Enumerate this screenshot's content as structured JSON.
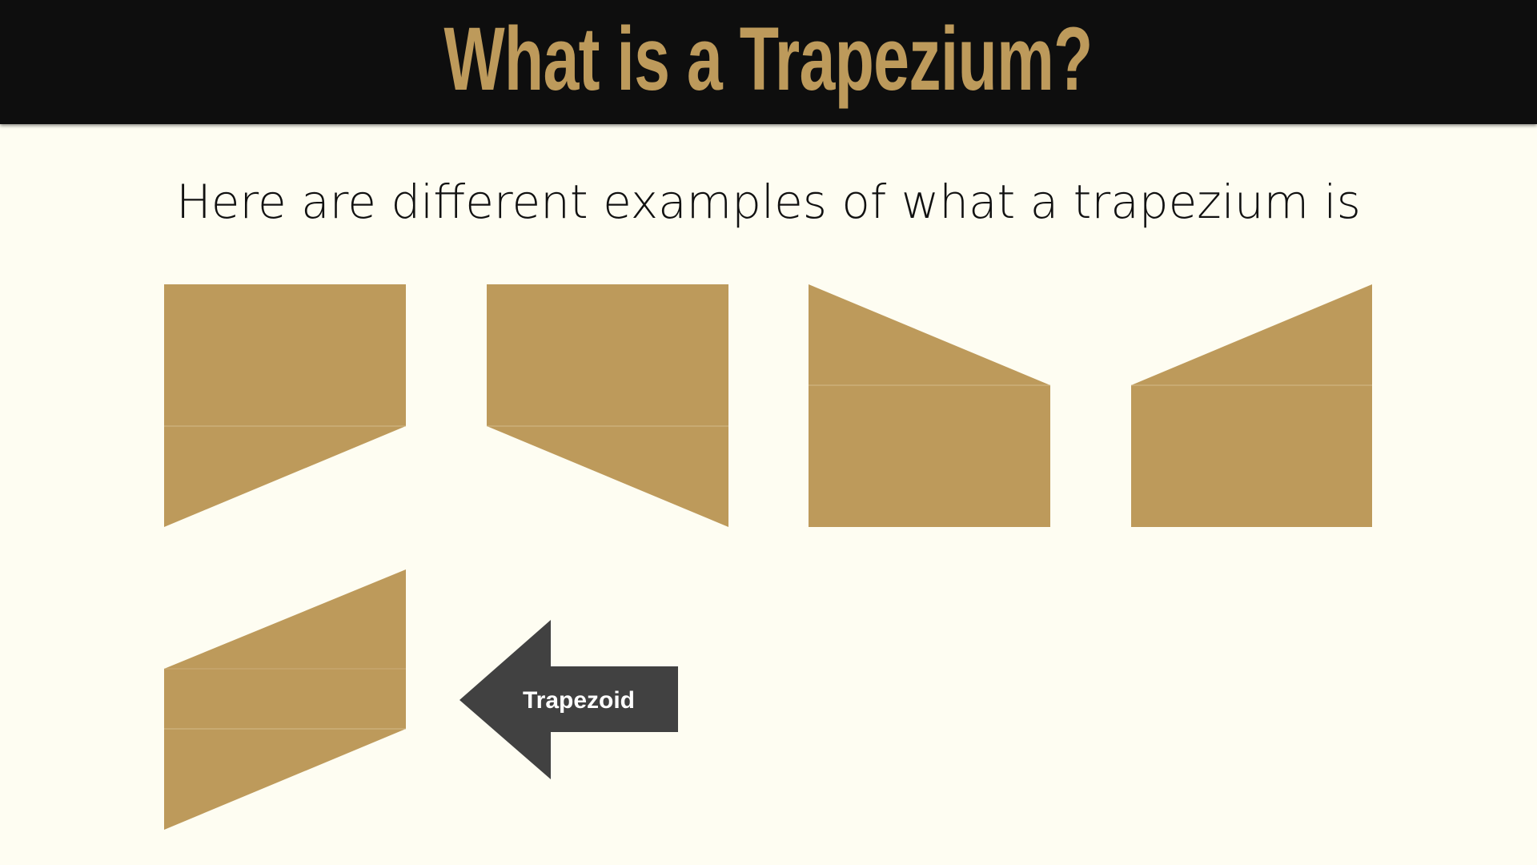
{
  "slide": {
    "title": "What is a Trapezium?",
    "subtitle": "Here are different examples of what a trapezium is"
  },
  "callout": {
    "label": "Trapezoid"
  },
  "colors": {
    "header_background": "#0e0e0e",
    "accent_gold": "#bd9a5b",
    "page_background": "#fefdf2",
    "arrow": "#414141"
  }
}
